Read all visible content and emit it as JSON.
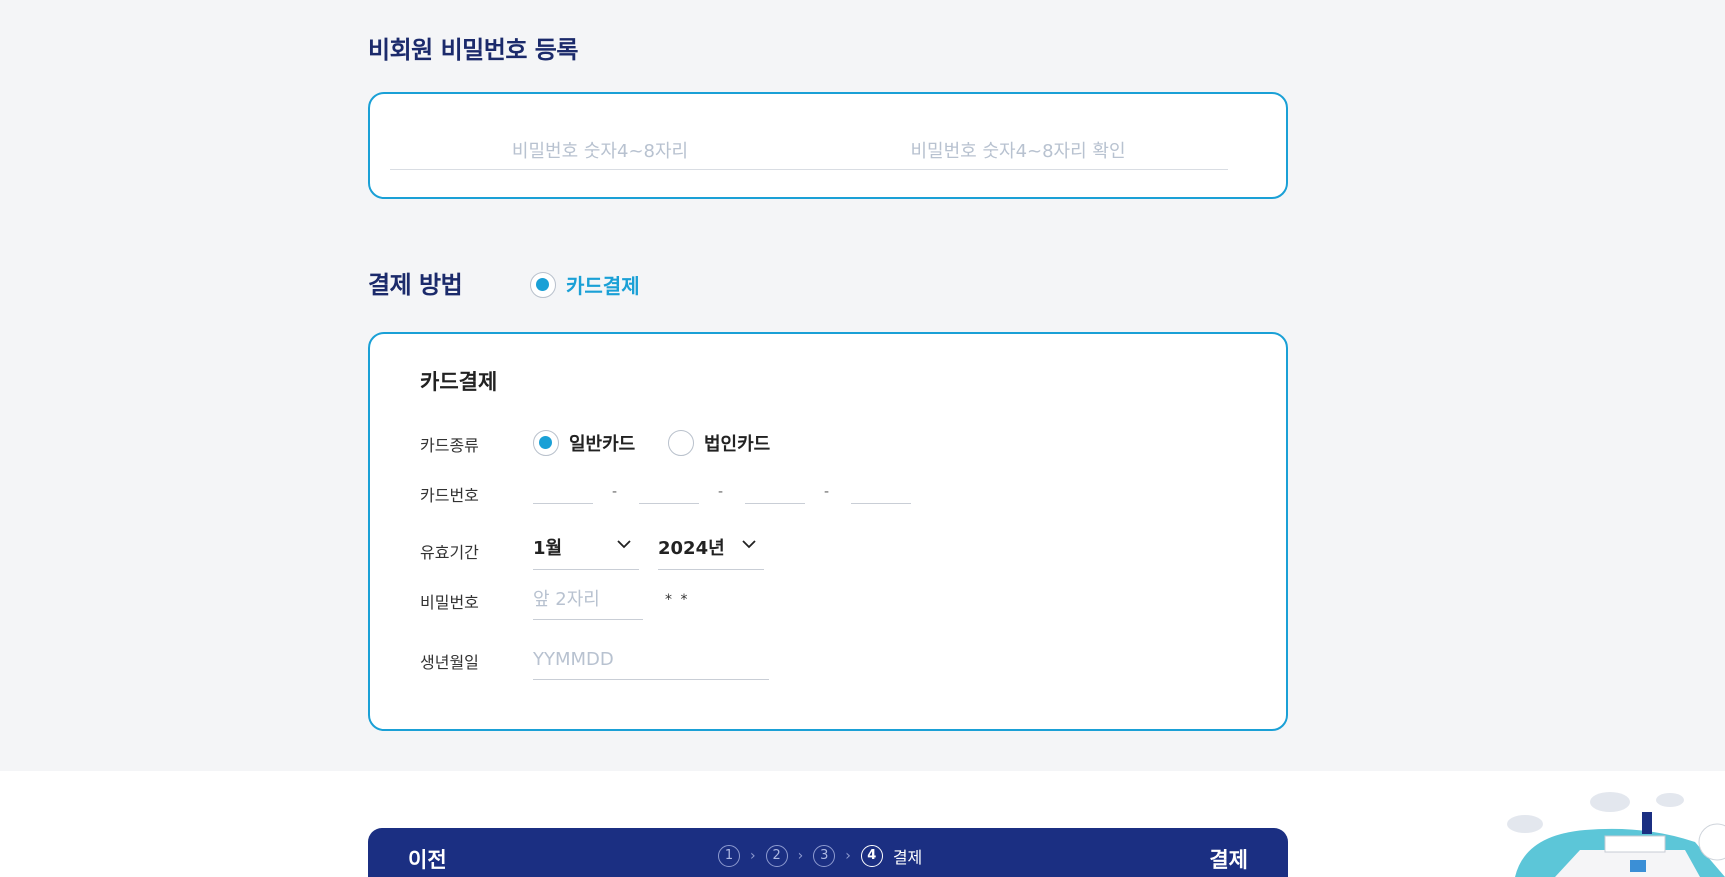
{
  "password_section": {
    "title": "비회원 비밀번호 등록",
    "password_placeholder": "비밀번호 숫자4~8자리",
    "confirm_placeholder": "비밀번호 숫자4~8자리 확인"
  },
  "payment_method": {
    "title": "결제 방법",
    "option_label": "카드결제",
    "selected": true
  },
  "card_payment": {
    "title": "카드결제",
    "card_type_label": "카드종류",
    "card_type_options": [
      "일반카드",
      "법인카드"
    ],
    "card_type_selected": "일반카드",
    "card_number_label": "카드번호",
    "card_number_separator": "-",
    "expiry_label": "유효기간",
    "expiry_month": "1월",
    "expiry_year": "2024년",
    "card_password_label": "비밀번호",
    "card_password_placeholder": "앞 2자리",
    "card_password_mask": "* *",
    "birth_label": "생년월일",
    "birth_placeholder": "YYMMDD"
  },
  "bottom_bar": {
    "prev_label": "이전",
    "pay_label": "결제",
    "steps": [
      "1",
      "2",
      "3",
      "4"
    ],
    "current_step_label": "결제"
  },
  "colors": {
    "accent": "#1aa0d6",
    "navy": "#1b2f82",
    "title": "#1b2a6b",
    "background": "#f4f5f7"
  }
}
